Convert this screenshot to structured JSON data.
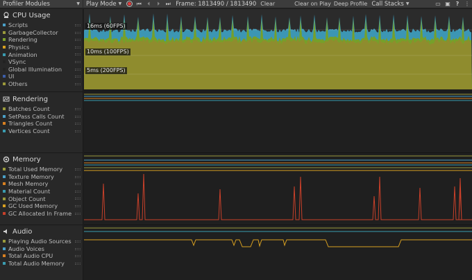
{
  "toolbar": {
    "modules_label": "Profiler Modules",
    "mode_label": "Play Mode",
    "frame_label": "Frame: 1813490 / 1813490",
    "clear_label": "Clear",
    "clear_on_play_label": "Clear on Play",
    "deep_profile_label": "Deep Profile",
    "call_stacks_label": "Call Stacks"
  },
  "modules": {
    "cpu": {
      "title": "CPU Usage",
      "icon": "cpu-icon",
      "items": [
        {
          "label": "Scripts",
          "color": "#4aa0c8"
        },
        {
          "label": "GarbageCollector",
          "color": "#9a9a3c"
        },
        {
          "label": "Rendering",
          "color": "#7ea22c"
        },
        {
          "label": "Physics",
          "color": "#d8a020"
        },
        {
          "label": "Animation",
          "color": "#3a9cb0"
        },
        {
          "label": "VSync",
          "color": "#222222"
        },
        {
          "label": "Global Illumination",
          "color": "#222222"
        },
        {
          "label": "UI",
          "color": "#3c5ea8"
        },
        {
          "label": "Others",
          "color": "#9c9a3a"
        }
      ],
      "fps_labels": [
        "16ms (60FPS)",
        "10ms (100FPS)",
        "5ms (200FPS)"
      ]
    },
    "rendering": {
      "title": "Rendering",
      "icon": "rendering-icon",
      "items": [
        {
          "label": "Batches Count",
          "color": "#9a9a3c"
        },
        {
          "label": "SetPass Calls Count",
          "color": "#4aa0c8"
        },
        {
          "label": "Triangles Count",
          "color": "#d88020"
        },
        {
          "label": "Vertices Count",
          "color": "#3a9cb0"
        }
      ]
    },
    "memory": {
      "title": "Memory",
      "icon": "memory-icon",
      "items": [
        {
          "label": "Total Used Memory",
          "color": "#9a9a3c"
        },
        {
          "label": "Texture Memory",
          "color": "#4aa0c8"
        },
        {
          "label": "Mesh Memory",
          "color": "#d88020"
        },
        {
          "label": "Material Count",
          "color": "#3a9cb0"
        },
        {
          "label": "Object Count",
          "color": "#9a9a3c"
        },
        {
          "label": "GC Used Memory",
          "color": "#d8a020"
        },
        {
          "label": "GC Allocated In Frame",
          "color": "#c8402a"
        }
      ]
    },
    "audio": {
      "title": "Audio",
      "icon": "audio-icon",
      "items": [
        {
          "label": "Playing Audio Sources",
          "color": "#9a9a3c"
        },
        {
          "label": "Audio Voices",
          "color": "#4aa0c8"
        },
        {
          "label": "Total Audio CPU",
          "color": "#d88020"
        },
        {
          "label": "Total Audio Memory",
          "color": "#3a9cb0"
        }
      ]
    }
  }
}
